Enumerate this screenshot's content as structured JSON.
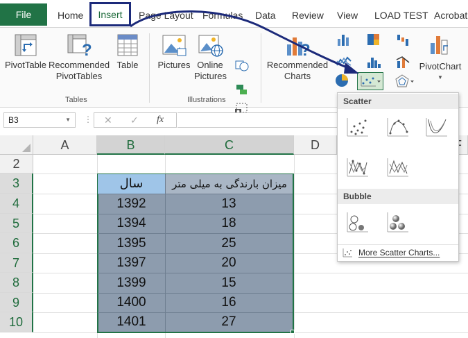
{
  "tabs": {
    "file": "File",
    "home": "Home",
    "insert": "Insert",
    "page_layout": "Page Layout",
    "formulas": "Formulas",
    "data": "Data",
    "review": "Review",
    "view": "View",
    "load_test": "LOAD TEST",
    "acrobat": "Acrobat"
  },
  "ribbon": {
    "pivot_table": "PivotTable",
    "recommended_pivot_1": "Recommended",
    "recommended_pivot_2": "PivotTables",
    "table": "Table",
    "tables_group": "Tables",
    "pictures": "Pictures",
    "online_pictures_1": "Online",
    "online_pictures_2": "Pictures",
    "illustrations_group": "Illustrations",
    "recommended_charts_1": "Recommended",
    "recommended_charts_2": "Charts",
    "pivot_chart": "PivotChart"
  },
  "formula_bar": {
    "name_box": "B3",
    "fx_label": "fx",
    "cancel": "✕",
    "enter": "✓"
  },
  "sheet": {
    "columns": [
      "A",
      "B",
      "C",
      "D",
      "F"
    ],
    "rows": [
      "2",
      "3",
      "4",
      "5",
      "6",
      "7",
      "8",
      "9",
      "10"
    ],
    "header_b": "سال",
    "header_c": "میزان بارندگی به میلی متر",
    "years": [
      "1392",
      "1394",
      "1395",
      "1397",
      "1399",
      "1400",
      "1401"
    ],
    "rainfall": [
      "13",
      "18",
      "25",
      "20",
      "15",
      "16",
      "27"
    ]
  },
  "scatter_menu": {
    "scatter_heading": "Scatter",
    "bubble_heading": "Bubble",
    "more_link": "More Scatter Charts..."
  },
  "colors": {
    "excel_green": "#217346",
    "selection_fill": "#8d9cae",
    "header_blue": "#9fc5e8",
    "annotation_navy": "#1c2a7a"
  }
}
